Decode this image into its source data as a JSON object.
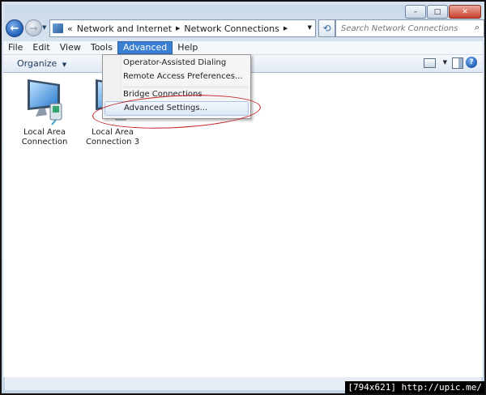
{
  "window": {
    "caption": {
      "minimize": "–",
      "maximize": "□",
      "close": "✕"
    }
  },
  "navigation": {
    "back_icon": "back-arrow-icon",
    "forward_icon": "forward-arrow-icon",
    "address": {
      "overflow": "«",
      "crumbs": [
        "Network and Internet",
        "Network Connections"
      ]
    },
    "search_placeholder": "Search Network Connections"
  },
  "menubar": {
    "items": [
      "File",
      "Edit",
      "View",
      "Tools",
      "Advanced",
      "Help"
    ],
    "active_index": 4
  },
  "command_bar": {
    "organize": "Organize"
  },
  "advanced_menu": {
    "items": [
      "Operator-Assisted Dialing",
      "Remote Access Preferences...",
      "Bridge Connections",
      "Advanced Settings..."
    ],
    "highlighted_index": 3
  },
  "connections": [
    {
      "line1": "Local Area",
      "line2": "Connection"
    },
    {
      "line1": "Local Area",
      "line2": "Connection 3"
    }
  ],
  "annotation_color": "#c21f1f",
  "watermark": "[794x621] http://upic.me/"
}
